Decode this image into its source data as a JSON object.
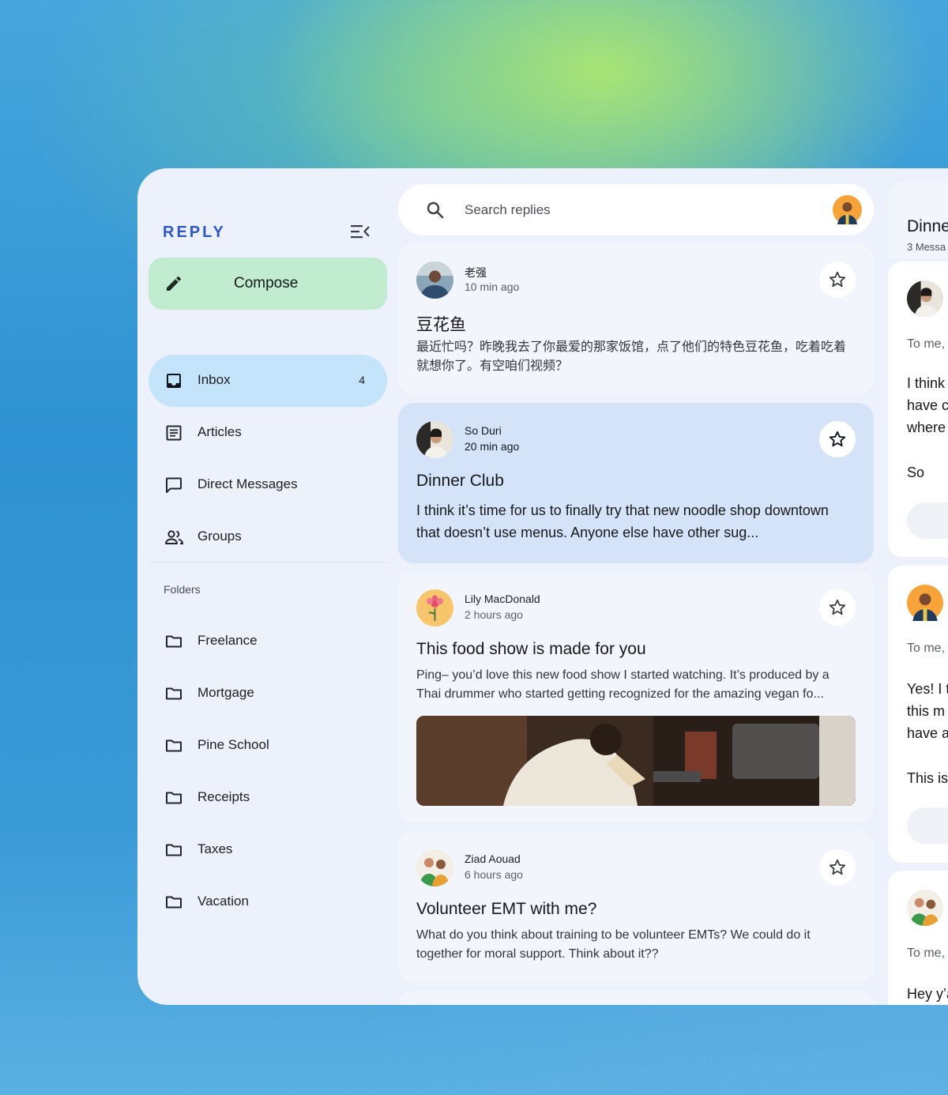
{
  "app": {
    "brand": "REPLY"
  },
  "compose": {
    "label": "Compose"
  },
  "nav": [
    {
      "label": "Inbox",
      "count": "4",
      "icon": "inbox-icon"
    },
    {
      "label": "Articles",
      "icon": "article-icon"
    },
    {
      "label": "Direct Messages",
      "icon": "chat-icon"
    },
    {
      "label": "Groups",
      "icon": "groups-icon"
    }
  ],
  "folders": {
    "heading": "Folders",
    "items": [
      "Freelance",
      "Mortgage",
      "Pine School",
      "Receipts",
      "Taxes",
      "Vacation"
    ]
  },
  "search": {
    "placeholder": "Search replies"
  },
  "emails": [
    {
      "sender": "老强",
      "time": "10 min ago",
      "subject": "豆花鱼",
      "preview": "最近忙吗？昨晚我去了你最爱的那家饭馆，点了他们的特色豆花鱼，吃着吃着就想你了。有空咱们视频？"
    },
    {
      "sender": "So Duri",
      "time": "20 min ago",
      "subject": "Dinner Club",
      "preview": "I think it’s time for us to finally try that new noodle shop downtown that doesn’t use menus. Anyone else have other sug..."
    },
    {
      "sender": "Lily MacDonald",
      "time": "2 hours ago",
      "subject": "This food show is made for you",
      "preview": "Ping– you’d love this new food show I started watching. It’s produced by a Thai drummer who started getting recognized for the amazing vegan fo..."
    },
    {
      "sender": "Ziad Aouad",
      "time": "6 hours ago",
      "subject": "Volunteer EMT with me?",
      "preview": "What do you think about training to be volunteer EMTs? We could do it together for moral support. Think about it??"
    }
  ],
  "detail": {
    "title": "Dinne",
    "count": "3 Messa",
    "messages": [
      {
        "to": "To me,",
        "lines": [
          "I think",
          "have c",
          "where",
          "",
          "So"
        ]
      },
      {
        "to": "To me,",
        "lines": [
          "Yes! I t",
          "this m",
          "have a",
          "",
          "This is"
        ]
      },
      {
        "to": "To me,",
        "lines": [
          "Hey y’a"
        ]
      }
    ]
  },
  "colors": {
    "brand": "#2e57c8",
    "compose_bg": "#c2ecd0",
    "nav_active_bg": "#c3e4fb",
    "selected_card_bg": "#d5e3f9",
    "surface": "#edf1fb"
  }
}
